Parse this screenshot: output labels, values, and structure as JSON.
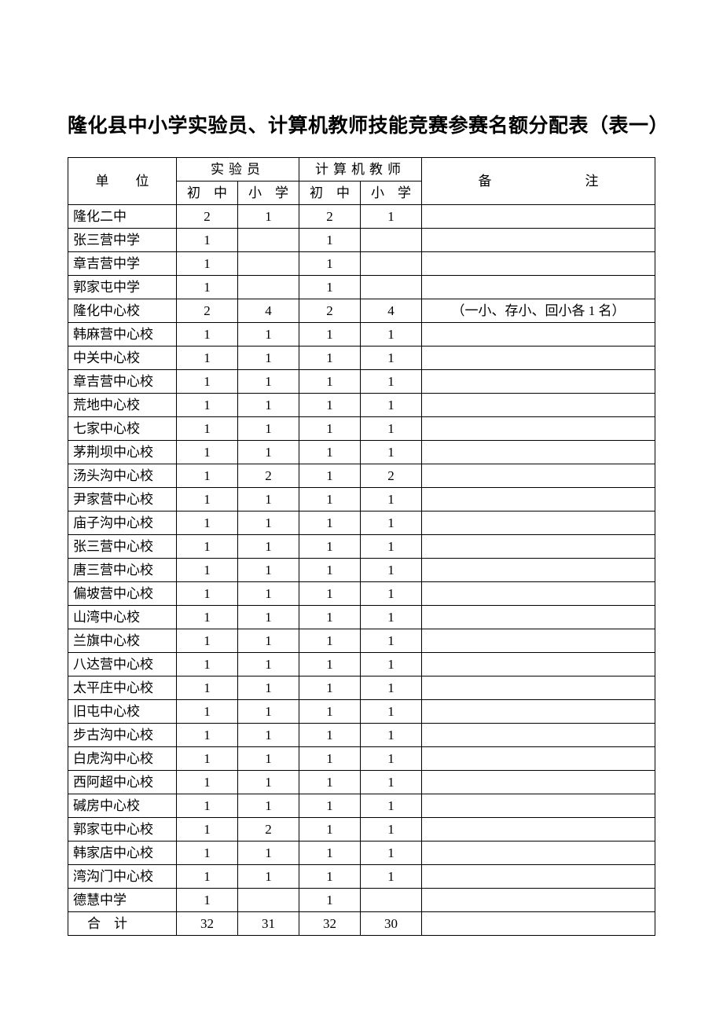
{
  "title": "隆化县中小学实验员、计算机教师技能竞赛参赛名额分配表（表一）",
  "headers": {
    "unit": "单位",
    "group_exp": "实验员",
    "group_it": "计算机教师",
    "middle": "初中",
    "primary": "小学",
    "note": "备注"
  },
  "rows": [
    {
      "unit": "隆化二中",
      "em": "2",
      "ep": "1",
      "im": "2",
      "ip": "1",
      "note": ""
    },
    {
      "unit": "张三营中学",
      "em": "1",
      "ep": "",
      "im": "1",
      "ip": "",
      "note": ""
    },
    {
      "unit": "章吉营中学",
      "em": "1",
      "ep": "",
      "im": "1",
      "ip": "",
      "note": ""
    },
    {
      "unit": "郭家屯中学",
      "em": "1",
      "ep": "",
      "im": "1",
      "ip": "",
      "note": ""
    },
    {
      "unit": "隆化中心校",
      "em": "2",
      "ep": "4",
      "im": "2",
      "ip": "4",
      "note": "（一小、存小、回小各 1 名）"
    },
    {
      "unit": "韩麻营中心校",
      "em": "1",
      "ep": "1",
      "im": "1",
      "ip": "1",
      "note": ""
    },
    {
      "unit": "中关中心校",
      "em": "1",
      "ep": "1",
      "im": "1",
      "ip": "1",
      "note": ""
    },
    {
      "unit": "章吉营中心校",
      "em": "1",
      "ep": "1",
      "im": "1",
      "ip": "1",
      "note": ""
    },
    {
      "unit": "荒地中心校",
      "em": "1",
      "ep": "1",
      "im": "1",
      "ip": "1",
      "note": ""
    },
    {
      "unit": "七家中心校",
      "em": "1",
      "ep": "1",
      "im": "1",
      "ip": "1",
      "note": ""
    },
    {
      "unit": "茅荆坝中心校",
      "em": "1",
      "ep": "1",
      "im": "1",
      "ip": "1",
      "note": ""
    },
    {
      "unit": "汤头沟中心校",
      "em": "1",
      "ep": "2",
      "im": "1",
      "ip": "2",
      "note": ""
    },
    {
      "unit": "尹家营中心校",
      "em": "1",
      "ep": "1",
      "im": "1",
      "ip": "1",
      "note": ""
    },
    {
      "unit": "庙子沟中心校",
      "em": "1",
      "ep": "1",
      "im": "1",
      "ip": "1",
      "note": ""
    },
    {
      "unit": "张三营中心校",
      "em": "1",
      "ep": "1",
      "im": "1",
      "ip": "1",
      "note": ""
    },
    {
      "unit": "唐三营中心校",
      "em": "1",
      "ep": "1",
      "im": "1",
      "ip": "1",
      "note": ""
    },
    {
      "unit": "偏坡营中心校",
      "em": "1",
      "ep": "1",
      "im": "1",
      "ip": "1",
      "note": ""
    },
    {
      "unit": "山湾中心校",
      "em": "1",
      "ep": "1",
      "im": "1",
      "ip": "1",
      "note": ""
    },
    {
      "unit": "兰旗中心校",
      "em": "1",
      "ep": "1",
      "im": "1",
      "ip": "1",
      "note": ""
    },
    {
      "unit": "八达营中心校",
      "em": "1",
      "ep": "1",
      "im": "1",
      "ip": "1",
      "note": ""
    },
    {
      "unit": "太平庄中心校",
      "em": "1",
      "ep": "1",
      "im": "1",
      "ip": "1",
      "note": ""
    },
    {
      "unit": "旧屯中心校",
      "em": "1",
      "ep": "1",
      "im": "1",
      "ip": "1",
      "note": ""
    },
    {
      "unit": "步古沟中心校",
      "em": "1",
      "ep": "1",
      "im": "1",
      "ip": "1",
      "note": ""
    },
    {
      "unit": "白虎沟中心校",
      "em": "1",
      "ep": "1",
      "im": "1",
      "ip": "1",
      "note": ""
    },
    {
      "unit": "西阿超中心校",
      "em": "1",
      "ep": "1",
      "im": "1",
      "ip": "1",
      "note": ""
    },
    {
      "unit": "碱房中心校",
      "em": "1",
      "ep": "1",
      "im": "1",
      "ip": "1",
      "note": ""
    },
    {
      "unit": "郭家屯中心校",
      "em": "1",
      "ep": "2",
      "im": "1",
      "ip": "1",
      "note": ""
    },
    {
      "unit": "韩家店中心校",
      "em": "1",
      "ep": "1",
      "im": "1",
      "ip": "1",
      "note": ""
    },
    {
      "unit": "湾沟门中心校",
      "em": "1",
      "ep": "1",
      "im": "1",
      "ip": "1",
      "note": ""
    },
    {
      "unit": "德慧中学",
      "em": "1",
      "ep": "",
      "im": "1",
      "ip": "",
      "note": ""
    }
  ],
  "total": {
    "label": "合计",
    "em": "32",
    "ep": "31",
    "im": "32",
    "ip": "30",
    "note": ""
  }
}
